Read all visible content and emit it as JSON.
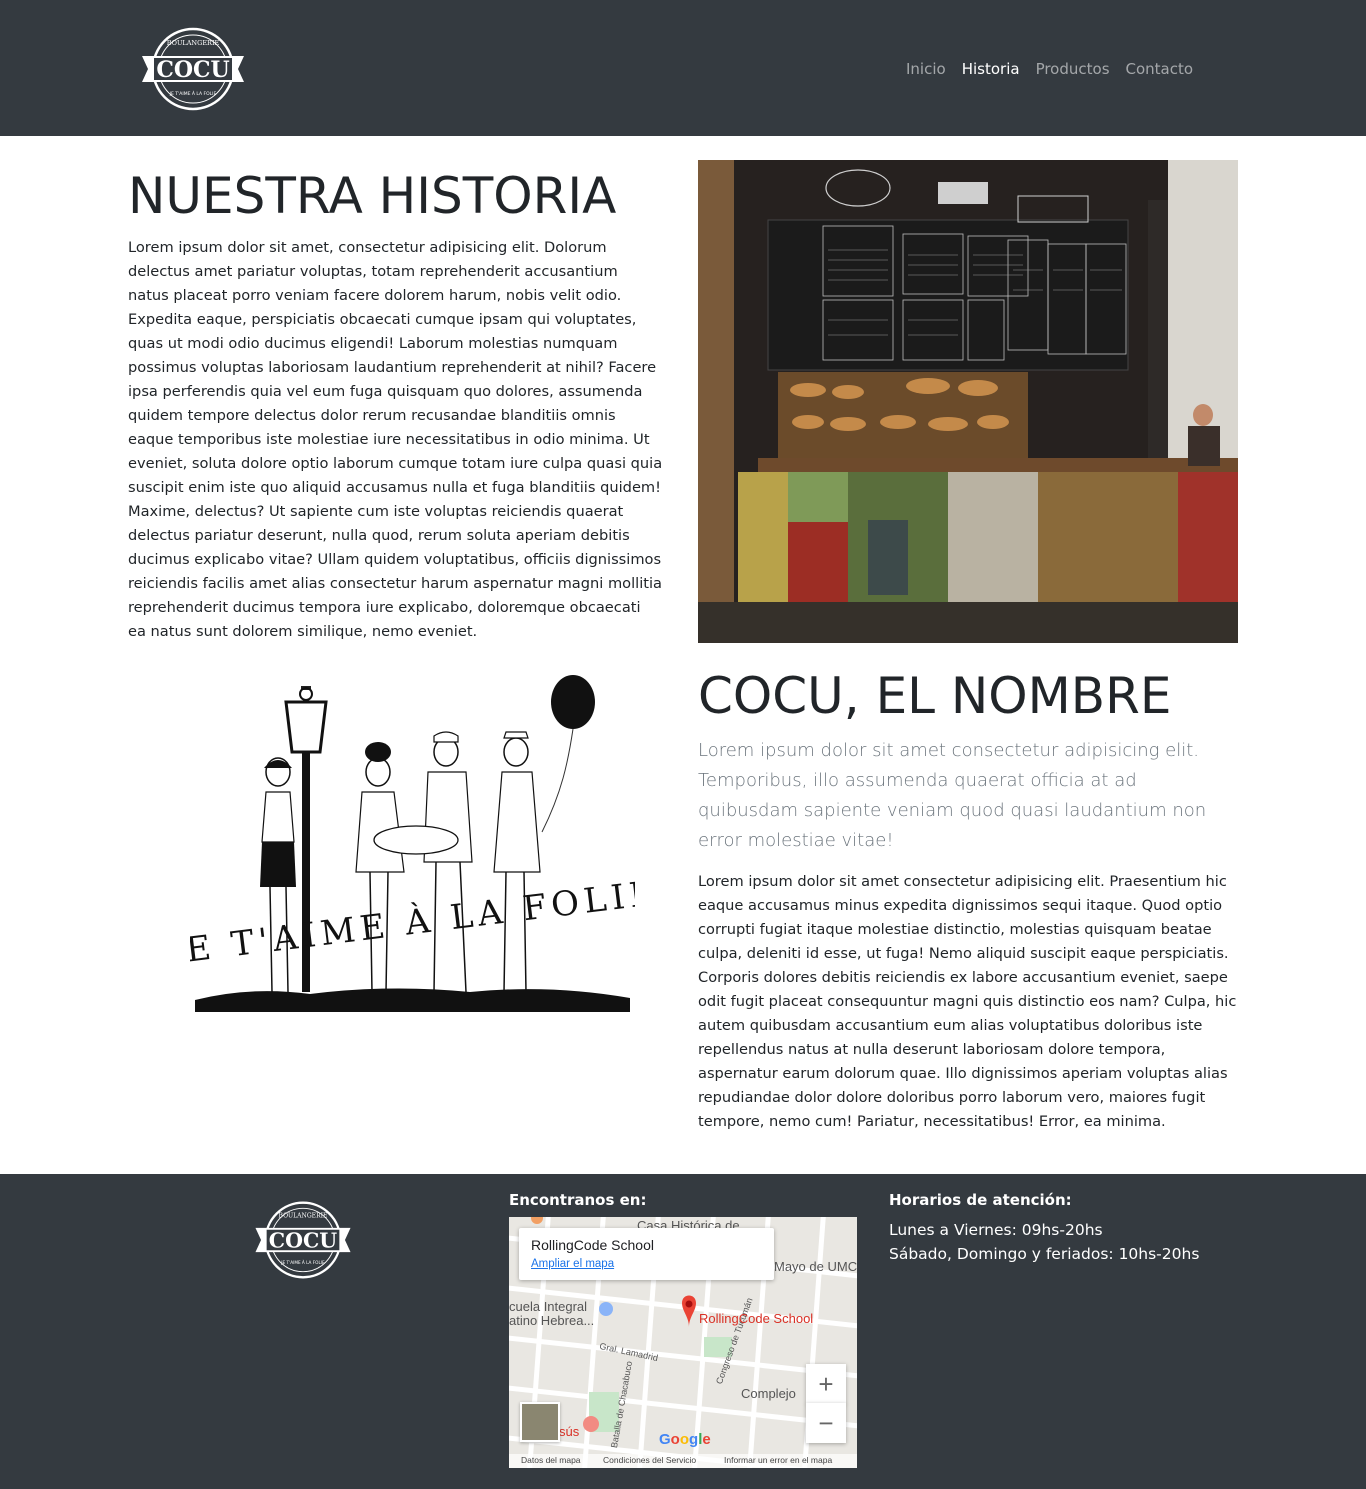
{
  "brand": {
    "logo_text": "COCU",
    "logo_top_text": "BOULANGERIE",
    "logo_bottom_text": "JE T'AIME À LA FOLIE"
  },
  "nav": {
    "items": [
      {
        "label": "Inicio"
      },
      {
        "label": "Historia"
      },
      {
        "label": "Productos"
      },
      {
        "label": "Contacto"
      }
    ],
    "active": "Historia"
  },
  "history": {
    "title": "NUESTRA HISTORIA",
    "body": "Lorem ipsum dolor sit amet, consectetur adipisicing elit. Dolorum delectus amet pariatur voluptas, totam reprehenderit accusantium natus placeat porro veniam facere dolorem harum, nobis velit odio. Expedita eaque, perspiciatis obcaecati cumque ipsam qui voluptates, quas ut modi odio ducimus eligendi! Laborum molestias numquam possimus voluptas laboriosam laudantium reprehenderit at nihil? Facere ipsa perferendis quia vel eum fuga quisquam quo dolores, assumenda quidem tempore delectus dolor rerum recusandae blanditiis omnis eaque temporibus iste molestiae iure necessitatibus in odio minima. Ut eveniet, soluta dolore optio laborum cumque totam iure culpa quasi quia suscipit enim iste quo aliquid accusamus nulla et fuga blanditiis quidem! Maxime, delectus? Ut sapiente cum iste voluptas reiciendis quaerat delectus pariatur deserunt, nulla quod, rerum soluta aperiam debitis ducimus explicabo vitae? Ullam quidem voluptatibus, officiis dignissimos reiciendis facilis amet alias consectetur harum aspernatur magni mollitia reprehenderit ducimus tempora iure explicabo, doloremque obcaecati ea natus sunt dolorem similique, nemo eveniet."
  },
  "drawing": {
    "caption": "JE T'AIME À LA FOLIE"
  },
  "name_section": {
    "title": "COCU, EL NOMBRE",
    "lead": "Lorem ipsum dolor sit amet consectetur adipisicing elit. Temporibus, illo assumenda quaerat officia at ad quibusdam sapiente veniam quod quasi laudantium non error molestiae vitae!",
    "body": "Lorem ipsum dolor sit amet consectetur adipisicing elit. Praesentium hic eaque accusamus minus expedita dignissimos sequi itaque. Quod optio corrupti fugiat itaque molestiae distinctio, molestias quisquam beatae culpa, deleniti id esse, ut fuga! Nemo aliquid suscipit eaque perspiciatis. Corporis dolores debitis reiciendis ex labore accusantium eveniet, saepe odit fugit placeat consequuntur magni quis distinctio eos nam? Culpa, hic autem quibusdam accusantium eum alias voluptatibus doloribus iste repellendus natus at nulla deserunt laboriosam dolore tempora, aspernatur earum dolorum quae. Illo dignissimos aperiam voluptas alias repudiandae dolor dolore doloribus porro laborum vero, maiores fugit tempore, nemo cum! Pariatur, necessitatibus! Error, ea minima."
  },
  "footer": {
    "find_us_heading": "Encontranos en:",
    "hours_heading": "Horarios de atención:",
    "hours": [
      "Lunes a Viernes: 09hs-20hs",
      "Sábado, Domingo y feriados: 10hs-20hs"
    ],
    "map": {
      "place_name": "RollingCode School",
      "enlarge_link": "Ampliar el mapa",
      "pin_label": "RollingCode School",
      "labels": [
        "Mayo de UMC",
        "cuela Integral",
        "atino Hebrea...",
        "Gral. Lamadrid",
        "Complejo",
        "Congreso de Tucumán",
        "Batalla de Chacabuco",
        "Casa Histórica de",
        "sús"
      ],
      "zoom_in": "+",
      "zoom_out": "−",
      "logo": "Google",
      "footer_links": [
        "Datos del mapa",
        "Condiciones del Servicio",
        "Informar un error en el mapa"
      ]
    }
  },
  "colors": {
    "navbar_bg": "#343a40",
    "footer_bg": "#343a40",
    "nav_active": "#ffffff",
    "nav_inactive": "rgba(255,255,255,0.55)",
    "map_pin": "#d93025"
  }
}
